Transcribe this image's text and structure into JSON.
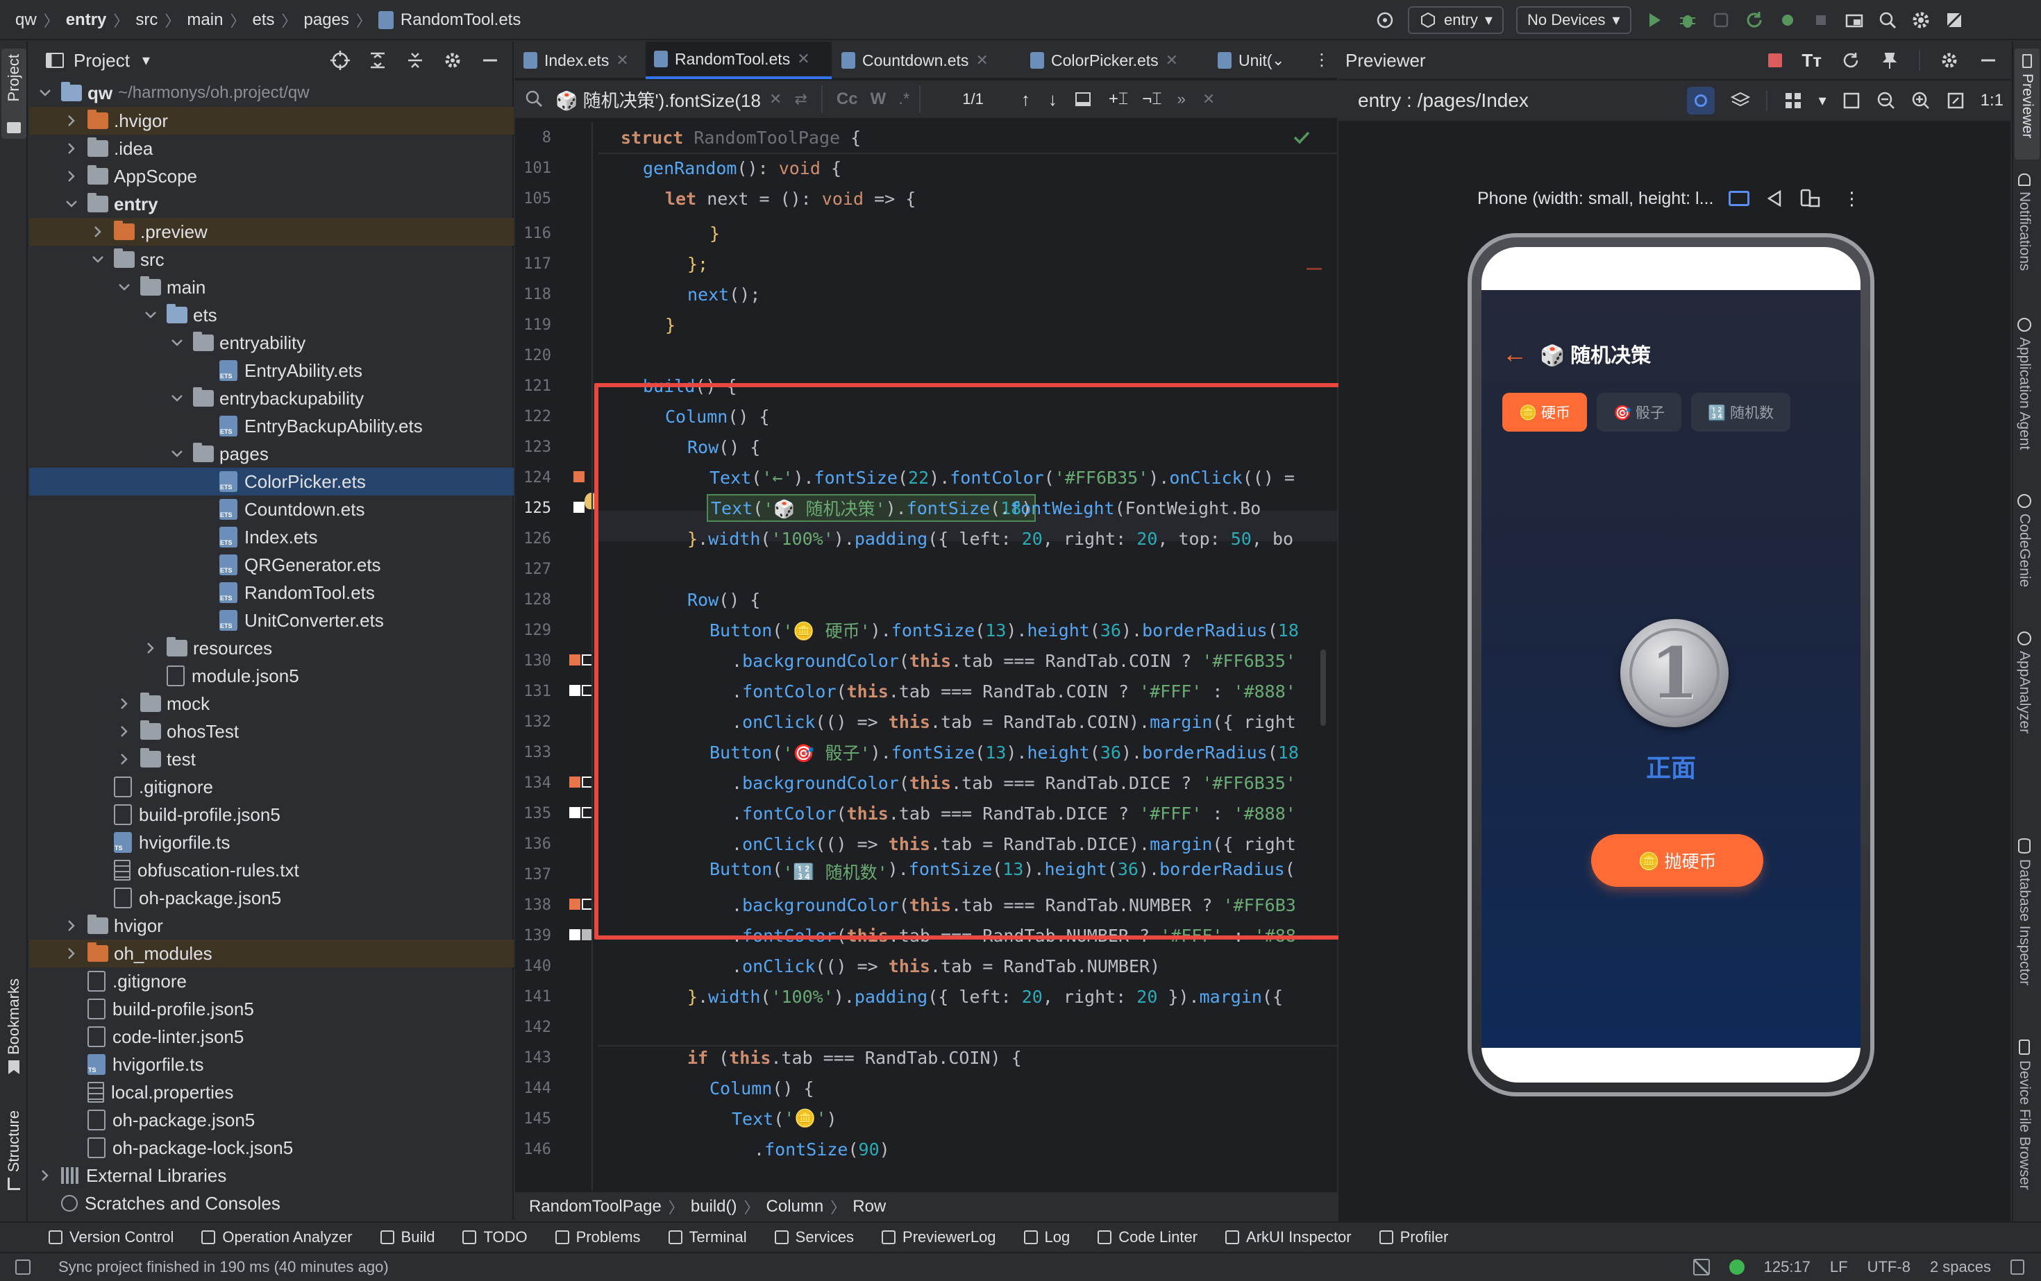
{
  "breadcrumbs": [
    "qw",
    "entry",
    "src",
    "main",
    "ets",
    "pages",
    "RandomTool.ets"
  ],
  "topbar": {
    "run_config": "entry",
    "device": "No Devices"
  },
  "left_stripe": {
    "project": "Project",
    "bookmarks": "Bookmarks",
    "structure": "Structure"
  },
  "project": {
    "title": "Project",
    "root": {
      "name": "qw",
      "path": "~/harmonys/oh.project/qw"
    },
    "items": [
      {
        "label": ".hvigor",
        "kind": "folder-orange",
        "depth": 1,
        "chev": ">",
        "hl": true
      },
      {
        "label": ".idea",
        "kind": "folder",
        "depth": 1,
        "chev": ">"
      },
      {
        "label": "AppScope",
        "kind": "folder",
        "depth": 1,
        "chev": ">"
      },
      {
        "label": "entry",
        "kind": "folder",
        "depth": 1,
        "chev": "v",
        "bold": true
      },
      {
        "label": ".preview",
        "kind": "folder-orange",
        "depth": 2,
        "chev": ">",
        "hl": true
      },
      {
        "label": "src",
        "kind": "folder",
        "depth": 2,
        "chev": "v"
      },
      {
        "label": "main",
        "kind": "folder",
        "depth": 3,
        "chev": "v"
      },
      {
        "label": "ets",
        "kind": "folder-blue",
        "depth": 4,
        "chev": "v"
      },
      {
        "label": "entryability",
        "kind": "folder",
        "depth": 5,
        "chev": "v"
      },
      {
        "label": "EntryAbility.ets",
        "kind": "ets",
        "depth": 6
      },
      {
        "label": "entrybackupability",
        "kind": "folder",
        "depth": 5,
        "chev": "v"
      },
      {
        "label": "EntryBackupAbility.ets",
        "kind": "ets",
        "depth": 6
      },
      {
        "label": "pages",
        "kind": "folder",
        "depth": 5,
        "chev": "v"
      },
      {
        "label": "ColorPicker.ets",
        "kind": "ets",
        "depth": 6,
        "sel": true
      },
      {
        "label": "Countdown.ets",
        "kind": "ets",
        "depth": 6
      },
      {
        "label": "Index.ets",
        "kind": "ets",
        "depth": 6
      },
      {
        "label": "QRGenerator.ets",
        "kind": "ets",
        "depth": 6
      },
      {
        "label": "RandomTool.ets",
        "kind": "ets",
        "depth": 6
      },
      {
        "label": "UnitConverter.ets",
        "kind": "ets",
        "depth": 6
      },
      {
        "label": "resources",
        "kind": "folder",
        "depth": 4,
        "chev": ">"
      },
      {
        "label": "module.json5",
        "kind": "json",
        "depth": 4
      },
      {
        "label": "mock",
        "kind": "folder",
        "depth": 3,
        "chev": ">"
      },
      {
        "label": "ohosTest",
        "kind": "folder",
        "depth": 3,
        "chev": ">"
      },
      {
        "label": "test",
        "kind": "folder",
        "depth": 3,
        "chev": ">"
      },
      {
        "label": ".gitignore",
        "kind": "json",
        "depth": 2
      },
      {
        "label": "build-profile.json5",
        "kind": "json",
        "depth": 2
      },
      {
        "label": "hvigorfile.ts",
        "kind": "ts",
        "depth": 2
      },
      {
        "label": "obfuscation-rules.txt",
        "kind": "txt",
        "depth": 2
      },
      {
        "label": "oh-package.json5",
        "kind": "json",
        "depth": 2
      },
      {
        "label": "hvigor",
        "kind": "folder",
        "depth": 1,
        "chev": ">"
      },
      {
        "label": "oh_modules",
        "kind": "folder-orange",
        "depth": 1,
        "chev": ">",
        "hl": true
      },
      {
        "label": ".gitignore",
        "kind": "json",
        "depth": 1
      },
      {
        "label": "build-profile.json5",
        "kind": "json",
        "depth": 1
      },
      {
        "label": "code-linter.json5",
        "kind": "json",
        "depth": 1
      },
      {
        "label": "hvigorfile.ts",
        "kind": "ts",
        "depth": 1
      },
      {
        "label": "local.properties",
        "kind": "txt",
        "depth": 1
      },
      {
        "label": "oh-package.json5",
        "kind": "json",
        "depth": 1
      },
      {
        "label": "oh-package-lock.json5",
        "kind": "json",
        "depth": 1
      },
      {
        "label": "External Libraries",
        "kind": "lib",
        "depth": 0,
        "chev": ">"
      },
      {
        "label": "Scratches and Consoles",
        "kind": "scratch",
        "depth": 0
      }
    ]
  },
  "editor": {
    "tabs": [
      {
        "label": "Index.ets",
        "active": false
      },
      {
        "label": "RandomTool.ets",
        "active": true
      },
      {
        "label": "Countdown.ets",
        "active": false
      },
      {
        "label": "ColorPicker.ets",
        "active": false
      },
      {
        "label": "Unit(",
        "active": false
      }
    ],
    "find": {
      "query": "🎲 随机决策').fontSize(18",
      "match_count": "1/1"
    },
    "line_numbers": [
      "8",
      "101",
      "105",
      "116",
      "117",
      "118",
      "119",
      "120",
      "121",
      "122",
      "123",
      "124",
      "125",
      "126",
      "127",
      "128",
      "129",
      "130",
      "131",
      "132",
      "133",
      "134",
      "135",
      "136",
      "137",
      "138",
      "139",
      "140",
      "141",
      "142",
      "143",
      "144",
      "145",
      "146"
    ],
    "current_line": "125",
    "breadcrumb": [
      "RandomToolPage",
      "build()",
      "Column",
      "Row"
    ]
  },
  "previewer": {
    "title": "Previewer",
    "route": "entry : /pages/Index",
    "device_label": "Phone (width: small, height: l...",
    "app": {
      "back": "←",
      "title": "🎲 随机决策",
      "tabs": [
        {
          "label": "🪙 硬币",
          "active": true
        },
        {
          "label": "🎯 骰子",
          "active": false
        },
        {
          "label": "🔢 随机数",
          "active": false
        }
      ],
      "coin_value": "1",
      "result": "正面",
      "action": "🪙 抛硬币",
      "accent": "#FF6B35"
    }
  },
  "right_stripe": [
    "Previewer",
    "Notifications",
    "Application Agent",
    "CodeGenie",
    "AppAnalyzer",
    "Database Inspector",
    "Device File Browser"
  ],
  "bottom_tools": [
    "Version Control",
    "Operation Analyzer",
    "Build",
    "TODO",
    "Problems",
    "Terminal",
    "Services",
    "PreviewerLog",
    "Log",
    "Code Linter",
    "ArkUI Inspector",
    "Profiler"
  ],
  "status": {
    "message": "Sync project finished in 190 ms (40 minutes ago)",
    "position": "125:17",
    "line_sep": "LF",
    "encoding": "UTF-8",
    "indent": "2 spaces"
  }
}
